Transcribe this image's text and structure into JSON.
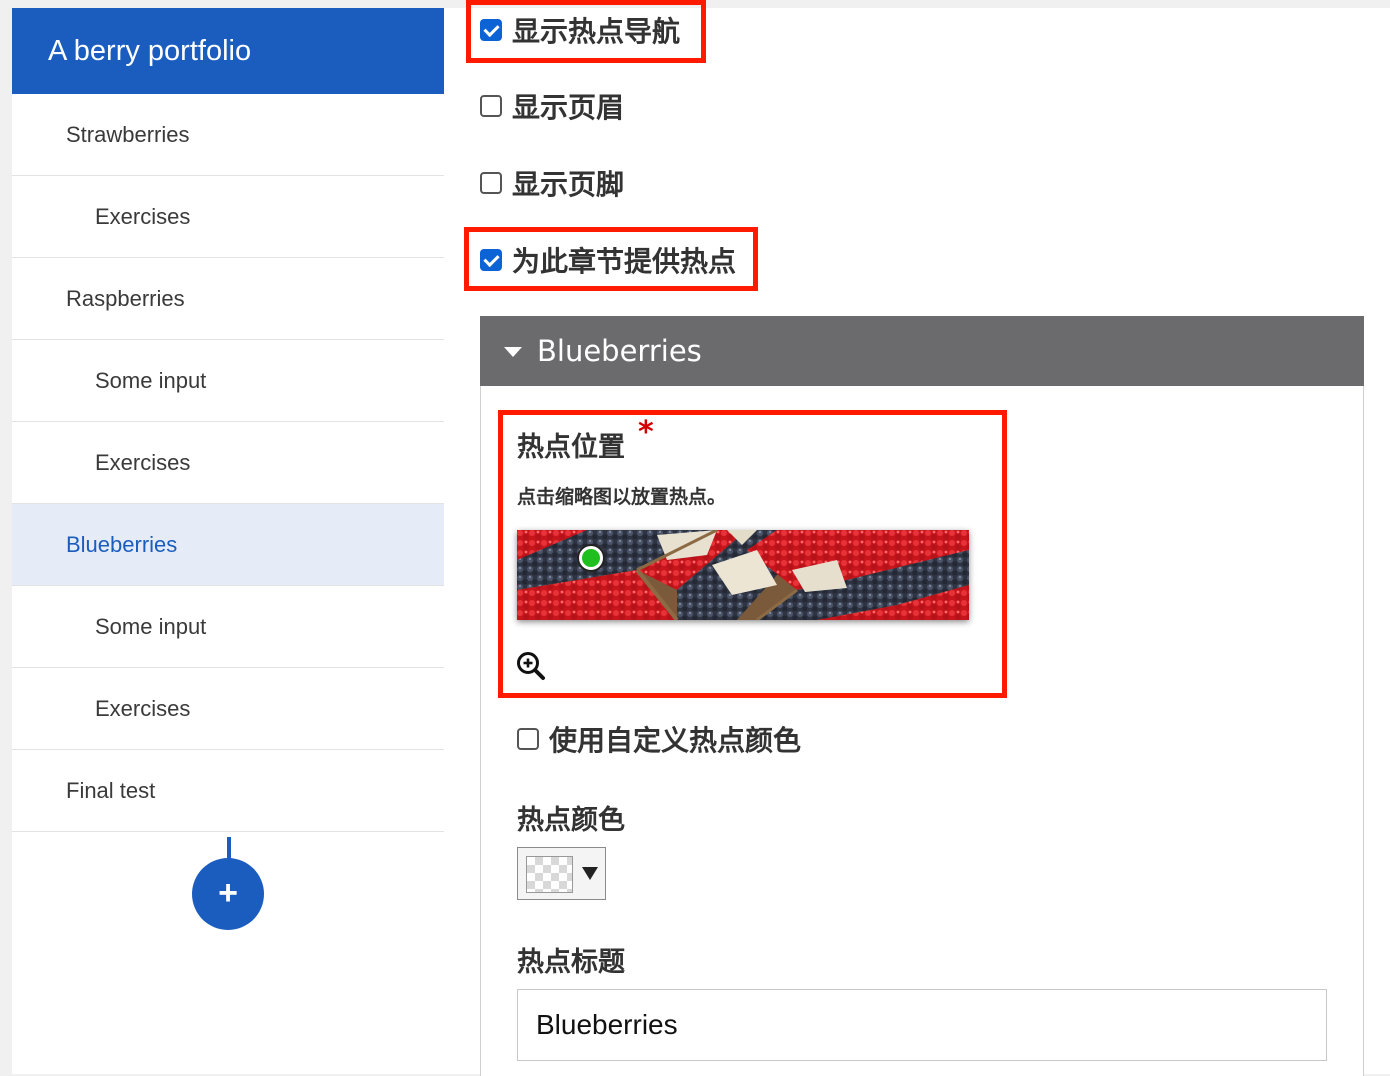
{
  "sidebar": {
    "title": "A berry portfolio",
    "items": [
      {
        "label": "Strawberries"
      },
      {
        "label": "Exercises"
      },
      {
        "label": "Raspberries"
      },
      {
        "label": "Some input"
      },
      {
        "label": "Exercises"
      },
      {
        "label": "Blueberries"
      },
      {
        "label": "Some input"
      },
      {
        "label": "Exercises"
      },
      {
        "label": "Final test"
      }
    ],
    "add_label": "+"
  },
  "options": {
    "show_hotspot_nav": {
      "label": "显示热点导航",
      "checked": true
    },
    "show_header": {
      "label": "显示页眉",
      "checked": false
    },
    "show_footer": {
      "label": "显示页脚",
      "checked": false
    },
    "provide_hotspot": {
      "label": "为此章节提供热点",
      "checked": true
    }
  },
  "section": {
    "title": "Blueberries",
    "hotspot_position_label": "热点位置",
    "required_mark": "*",
    "hotspot_hint": "点击缩略图以放置热点。",
    "custom_color": {
      "label": "使用自定义热点颜色",
      "checked": false
    },
    "hotspot_color_label": "热点颜色",
    "hotspot_title_label": "热点标题",
    "hotspot_title_value": "Blueberries"
  },
  "colors": {
    "brand": "#1a5dbf",
    "highlight": "#ff1a00",
    "section_header": "#6b6a6c",
    "hotspot": "#1fbf1f"
  }
}
